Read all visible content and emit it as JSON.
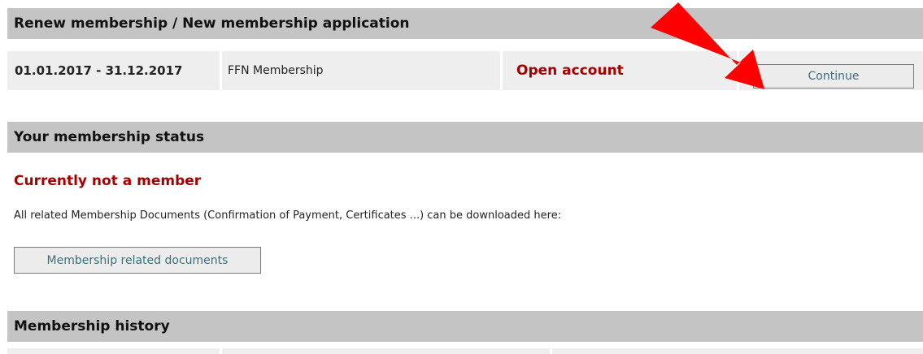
{
  "renew_section": {
    "title": "Renew membership / New membership application",
    "row": {
      "period": "01.01.2017 - 31.12.2017",
      "membership_type": "FFN Membership",
      "status": "Open account",
      "action_label": "Continue"
    }
  },
  "status_section": {
    "title": "Your membership status",
    "current_status": "Currently not a member",
    "description": "All related Membership Documents (Confirmation of Payment, Certificates ...) can be downloaded here:",
    "documents_button": "Membership related documents"
  },
  "history_section": {
    "title": "Membership history"
  },
  "colors": {
    "header_bg": "#c4c4c4",
    "row_bg": "#eeeeee",
    "alert_red": "#a50000",
    "button_text": "#3d6e7a",
    "arrow": "#ff0000"
  },
  "annotation": {
    "icon": "red-arrow-icon"
  }
}
